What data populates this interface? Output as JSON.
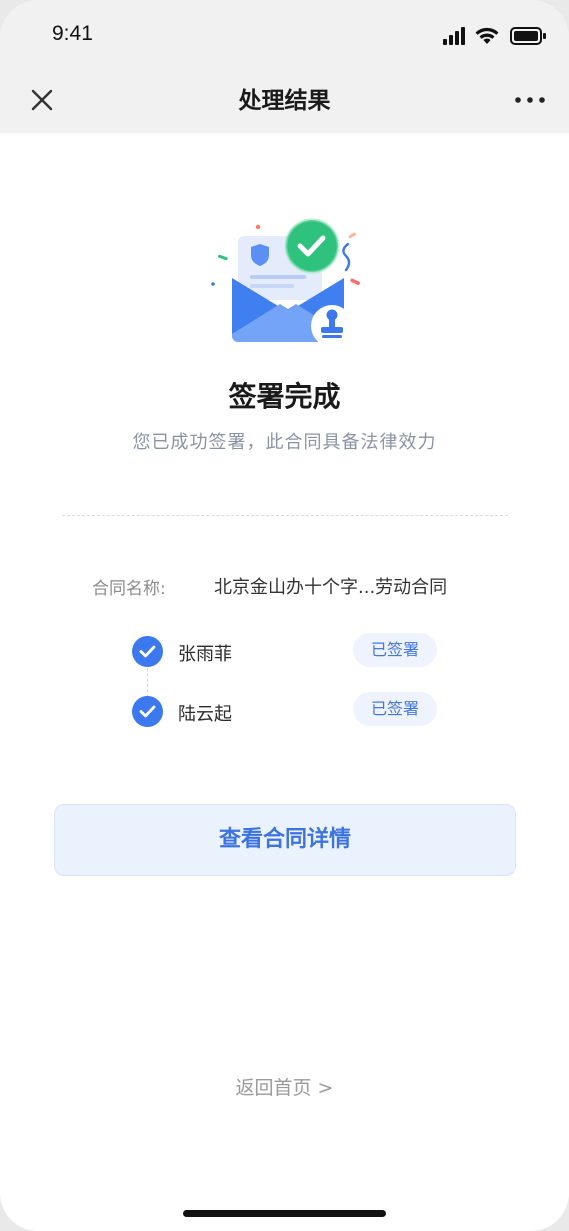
{
  "status_bar": {
    "time": "9:41"
  },
  "navbar": {
    "title": "处理结果"
  },
  "result": {
    "title": "签署完成",
    "subtitle": "您已成功签署，此合同具备法律效力"
  },
  "contract": {
    "label": "合同名称:",
    "name": "北京金山办十个字...劳动合同"
  },
  "signers": [
    {
      "name": "张雨菲",
      "status": "已签署"
    },
    {
      "name": "陆云起",
      "status": "已签署"
    }
  ],
  "actions": {
    "view_detail": "查看合同详情",
    "back_home": "返回首页 >"
  },
  "colors": {
    "accent": "#3c78ee",
    "success": "#2ec27e",
    "badge_bg": "#eef3fd",
    "button_bg": "#eaf2fe"
  },
  "icons": [
    "signal-icon",
    "wifi-icon",
    "battery-icon",
    "close-icon",
    "more-icon",
    "envelope-success-illustration",
    "check-icon"
  ]
}
